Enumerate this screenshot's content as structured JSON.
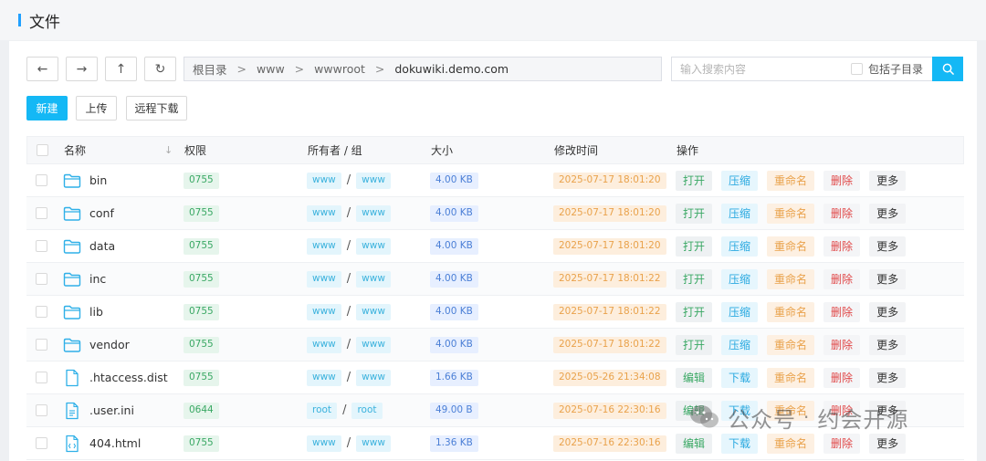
{
  "header": {
    "title": "文件"
  },
  "toolbar": {
    "back_label": "←",
    "forward_label": "→",
    "up_label": "↑",
    "refresh_label": "↻",
    "breadcrumb": [
      "根目录",
      "www",
      "wwwroot",
      "dokuwiki.demo.com"
    ],
    "breadcrumb_sep": ">",
    "search_placeholder": "输入搜索内容",
    "include_subdirs_label": "包括子目录",
    "new_label": "新建",
    "upload_label": "上传",
    "remote_download_label": "远程下载"
  },
  "table": {
    "headers": {
      "name": "名称",
      "perm": "权限",
      "owner": "所有者 / 组",
      "size": "大小",
      "time": "修改时间",
      "ops": "操作"
    },
    "owner_sep": "/",
    "rows": [
      {
        "type": "folder",
        "name": "bin",
        "perm": "0755",
        "owner": "www",
        "group": "www",
        "size": "4.00 KB",
        "time": "2025-07-17 18:01:20",
        "ops": [
          "打开",
          "压缩",
          "重命名",
          "删除",
          "更多"
        ]
      },
      {
        "type": "folder",
        "name": "conf",
        "perm": "0755",
        "owner": "www",
        "group": "www",
        "size": "4.00 KB",
        "time": "2025-07-17 18:01:20",
        "ops": [
          "打开",
          "压缩",
          "重命名",
          "删除",
          "更多"
        ]
      },
      {
        "type": "folder",
        "name": "data",
        "perm": "0755",
        "owner": "www",
        "group": "www",
        "size": "4.00 KB",
        "time": "2025-07-17 18:01:20",
        "ops": [
          "打开",
          "压缩",
          "重命名",
          "删除",
          "更多"
        ]
      },
      {
        "type": "folder",
        "name": "inc",
        "perm": "0755",
        "owner": "www",
        "group": "www",
        "size": "4.00 KB",
        "time": "2025-07-17 18:01:22",
        "ops": [
          "打开",
          "压缩",
          "重命名",
          "删除",
          "更多"
        ]
      },
      {
        "type": "folder",
        "name": "lib",
        "perm": "0755",
        "owner": "www",
        "group": "www",
        "size": "4.00 KB",
        "time": "2025-07-17 18:01:22",
        "ops": [
          "打开",
          "压缩",
          "重命名",
          "删除",
          "更多"
        ]
      },
      {
        "type": "folder",
        "name": "vendor",
        "perm": "0755",
        "owner": "www",
        "group": "www",
        "size": "4.00 KB",
        "time": "2025-07-17 18:01:22",
        "ops": [
          "打开",
          "压缩",
          "重命名",
          "删除",
          "更多"
        ]
      },
      {
        "type": "file",
        "name": ".htaccess.dist",
        "perm": "0755",
        "owner": "www",
        "group": "www",
        "size": "1.66 KB",
        "time": "2025-05-26 21:34:08",
        "ops": [
          "编辑",
          "下载",
          "重命名",
          "删除",
          "更多"
        ]
      },
      {
        "type": "file-text",
        "name": ".user.ini",
        "perm": "0644",
        "owner": "root",
        "group": "root",
        "size": "49.00 B",
        "time": "2025-07-16 22:30:16",
        "ops": [
          "编辑",
          "下载",
          "重命名",
          "删除",
          "更多"
        ]
      },
      {
        "type": "file-code",
        "name": "404.html",
        "perm": "0755",
        "owner": "www",
        "group": "www",
        "size": "1.36 KB",
        "time": "2025-07-16 22:30:16",
        "ops": [
          "编辑",
          "下载",
          "重命名",
          "删除",
          "更多"
        ]
      }
    ]
  },
  "watermark": {
    "left": "公众号",
    "dot": "·",
    "right": "约会开源"
  },
  "colors": {
    "accent": "#14b8f5",
    "folder": "#2fb0e8"
  }
}
